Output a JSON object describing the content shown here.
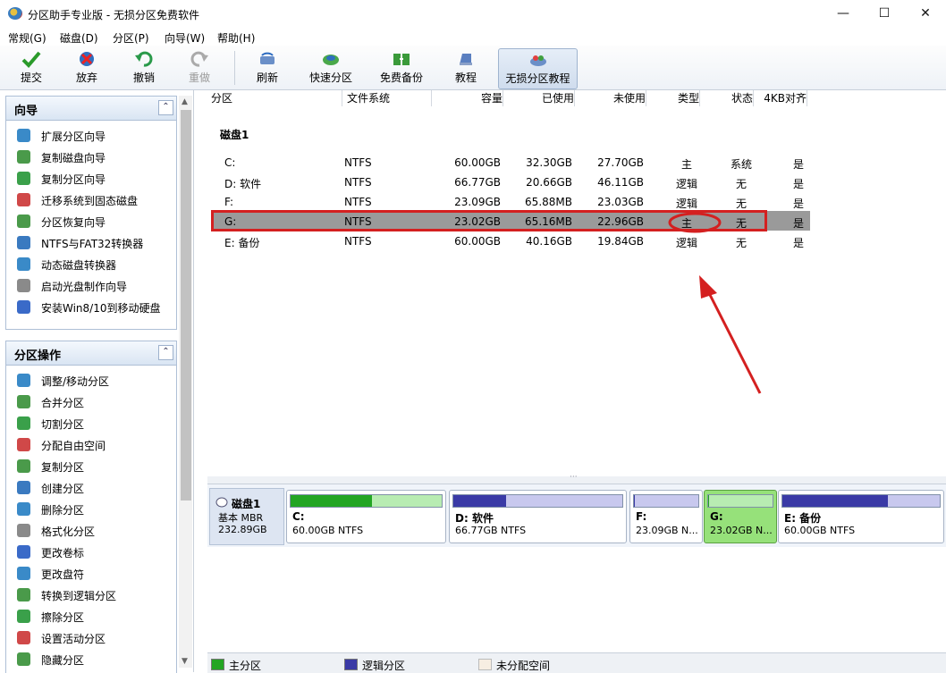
{
  "window": {
    "title": "分区助手专业版 - 无损分区免费软件",
    "minimize": "—",
    "maximize": "☐",
    "close": "✕"
  },
  "menu": [
    "常规(G)",
    "磁盘(D)",
    "分区(P)",
    "向导(W)",
    "帮助(H)"
  ],
  "toolbar": [
    {
      "label": "提交",
      "icon": "check-icon"
    },
    {
      "label": "放弃",
      "icon": "discard-icon"
    },
    {
      "label": "撤销",
      "icon": "undo-icon"
    },
    {
      "label": "重做",
      "icon": "redo-icon"
    },
    {
      "label": "刷新",
      "icon": "refresh-icon"
    },
    {
      "label": "快速分区",
      "icon": "quick-partition-icon"
    },
    {
      "label": "免费备份",
      "icon": "backup-icon"
    },
    {
      "label": "教程",
      "icon": "tutorial-icon"
    },
    {
      "label": "无损分区教程",
      "icon": "lossless-tutorial-icon"
    }
  ],
  "wizard_panel": {
    "title": "向导",
    "items": [
      "扩展分区向导",
      "复制磁盘向导",
      "复制分区向导",
      "迁移系统到固态磁盘",
      "分区恢复向导",
      "NTFS与FAT32转换器",
      "动态磁盘转换器",
      "启动光盘制作向导",
      "安装Win8/10到移动硬盘"
    ]
  },
  "ops_panel": {
    "title": "分区操作",
    "items": [
      "调整/移动分区",
      "合并分区",
      "切割分区",
      "分配自由空间",
      "复制分区",
      "创建分区",
      "删除分区",
      "格式化分区",
      "更改卷标",
      "更改盘符",
      "转换到逻辑分区",
      "擦除分区",
      "设置活动分区",
      "隐藏分区"
    ]
  },
  "table": {
    "columns": [
      "分区",
      "文件系统",
      "容量",
      "已使用",
      "未使用",
      "类型",
      "状态",
      "4KB对齐"
    ],
    "disk_label": "磁盘1",
    "rows": [
      {
        "name": "C:",
        "fs": "NTFS",
        "cap": "60.00GB",
        "used": "32.30GB",
        "free": "27.70GB",
        "type": "主",
        "status": "系统",
        "align": "是"
      },
      {
        "name": "D: 软件",
        "fs": "NTFS",
        "cap": "66.77GB",
        "used": "20.66GB",
        "free": "46.11GB",
        "type": "逻辑",
        "status": "无",
        "align": "是"
      },
      {
        "name": "F:",
        "fs": "NTFS",
        "cap": "23.09GB",
        "used": "65.88MB",
        "free": "23.03GB",
        "type": "逻辑",
        "status": "无",
        "align": "是"
      },
      {
        "name": "G:",
        "fs": "NTFS",
        "cap": "23.02GB",
        "used": "65.16MB",
        "free": "22.96GB",
        "type": "主",
        "status": "无",
        "align": "是"
      },
      {
        "name": "E: 备份",
        "fs": "NTFS",
        "cap": "60.00GB",
        "used": "40.16GB",
        "free": "19.84GB",
        "type": "逻辑",
        "status": "无",
        "align": "是"
      }
    ],
    "selected_row": 3
  },
  "diskmap": {
    "disk_name": "磁盘1",
    "disk_type": "基本 MBR",
    "disk_size": "232.89GB",
    "partitions": [
      {
        "name": "C:",
        "size": "60.00GB NTFS",
        "used_fraction": 0.54,
        "kind": "primary"
      },
      {
        "name": "D: 软件",
        "size": "66.77GB NTFS",
        "used_fraction": 0.31,
        "kind": "logical"
      },
      {
        "name": "F:",
        "size": "23.09GB N...",
        "used_fraction": 0.01,
        "kind": "logical"
      },
      {
        "name": "G:",
        "size": "23.02GB N...",
        "used_fraction": 0.01,
        "kind": "primary"
      },
      {
        "name": "E: 备份",
        "size": "60.00GB NTFS",
        "used_fraction": 0.67,
        "kind": "logical"
      }
    ]
  },
  "legend": [
    "主分区",
    "逻辑分区",
    "未分配空间"
  ],
  "colors": {
    "primary_fill": "#23a523",
    "primary_light": "#b8ecb2",
    "logical_fill": "#3a3aa6",
    "logical_light": "#c8c8ee",
    "selected_row": "#9a9a9a",
    "highlight_red": "#d42020"
  }
}
